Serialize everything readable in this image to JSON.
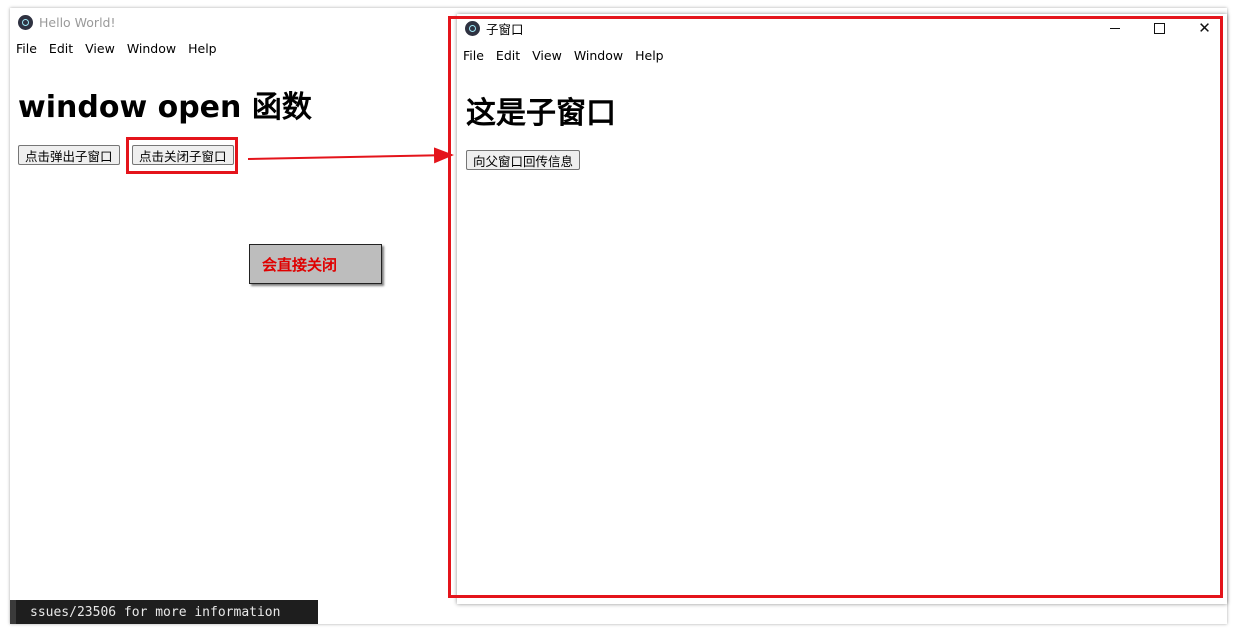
{
  "main_window": {
    "title": "Hello World!",
    "menu": [
      "File",
      "Edit",
      "View",
      "Window",
      "Help"
    ],
    "heading": "window open 函数",
    "buttons": {
      "open_child": "点击弹出子窗口",
      "close_child": "点击关闭子窗口"
    }
  },
  "terminal": {
    "text": "ssues/23506 for more information"
  },
  "child_window": {
    "title": "子窗口",
    "menu": [
      "File",
      "Edit",
      "View",
      "Window",
      "Help"
    ],
    "heading": "这是子窗口",
    "buttons": {
      "send_to_parent": "向父窗口回传信息"
    }
  },
  "annotation": {
    "note": "会直接关闭",
    "color": "#e4141b"
  }
}
